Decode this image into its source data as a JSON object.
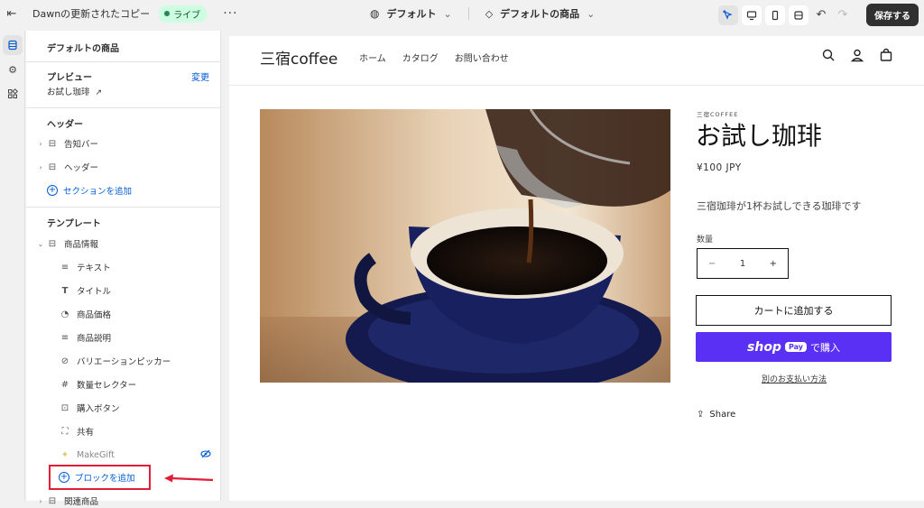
{
  "topbar": {
    "theme_name": "Dawnの更新されたコピー",
    "live_badge": "ライブ",
    "more": "···",
    "template_selector": "デフォルト",
    "page_selector": "デフォルトの商品",
    "save_label": "保存する"
  },
  "panel": {
    "title": "デフォルトの商品",
    "preview_heading": "プレビュー",
    "change_link": "変更",
    "preview_product": "お試し珈琲",
    "header_heading": "ヘッダー",
    "header_items": [
      {
        "label": "告知バー",
        "icon": "layout-icon"
      },
      {
        "label": "ヘッダー",
        "icon": "layout-icon"
      }
    ],
    "add_section": "セクションを追加",
    "template_heading": "テンプレート",
    "product_info": "商品情報",
    "blocks": [
      {
        "label": "テキスト",
        "icon": "text-lines-icon"
      },
      {
        "label": "タイトル",
        "icon": "title-t-icon"
      },
      {
        "label": "商品価格",
        "icon": "price-tag-icon"
      },
      {
        "label": "商品説明",
        "icon": "text-lines-icon"
      },
      {
        "label": "バリエーションピッカー",
        "icon": "variant-icon"
      },
      {
        "label": "数量セレクター",
        "icon": "hash-icon"
      },
      {
        "label": "購入ボタン",
        "icon": "buy-button-icon"
      },
      {
        "label": "共有",
        "icon": "share-frame-icon"
      },
      {
        "label": "MakeGift",
        "icon": "app-icon"
      }
    ],
    "add_block": "ブロックを追加",
    "next_section": "関連商品"
  },
  "store": {
    "logo": "三宿coffee",
    "nav": [
      "ホーム",
      "カタログ",
      "お問い合わせ"
    ],
    "vendor": "三宿COFFEE",
    "product_title": "お試し珈琲",
    "price": "¥100 JPY",
    "description": "三宿珈琲が1杯お試しできる珈琲です",
    "quantity_label": "数量",
    "quantity_value": "1",
    "qty_minus": "−",
    "qty_plus": "+",
    "add_to_cart": "カートに追加する",
    "shop_pay_logo": "shop",
    "shop_pay_pill": "Pay",
    "shop_pay_buy": "で購入",
    "alt_payment": "別のお支払い方法",
    "share": "Share"
  },
  "colors": {
    "accent": "#005bd3",
    "highlight": "#e11d38",
    "shop_pay": "#5a31f4",
    "live_badge_bg": "#cdfee1"
  }
}
